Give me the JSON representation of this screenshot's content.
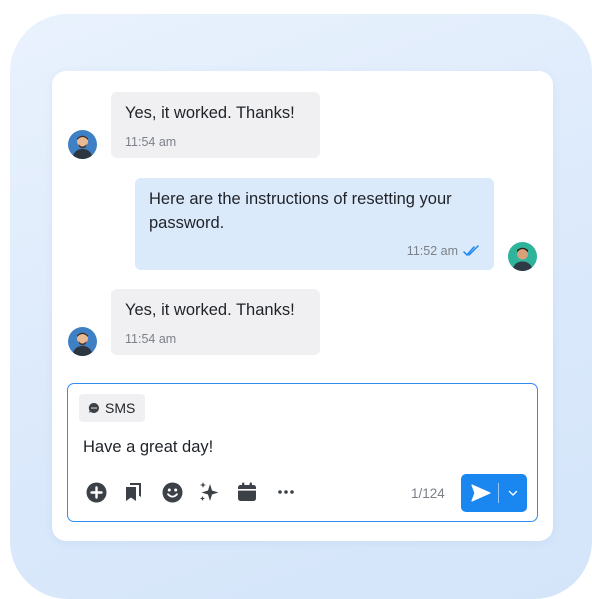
{
  "messages": [
    {
      "direction": "incoming",
      "text": "Yes, it worked. Thanks!",
      "time": "11:54 am"
    },
    {
      "direction": "outgoing",
      "text_line1": "Here are the instructions of resetting your",
      "text_line2": "password.",
      "time": "11:52 am",
      "status_icon": "double-check-icon"
    },
    {
      "direction": "incoming",
      "text": "Yes, it worked. Thanks!",
      "time": "11:54 am"
    }
  ],
  "composer": {
    "channel_label": "SMS",
    "channel_icon": "chat-bubble-icon",
    "message_text": "Have a great day!",
    "char_counter": "1/124",
    "tools": [
      "add-circle-icon",
      "bookmarks-icon",
      "emoji-icon",
      "sparkle-icon",
      "calendar-icon",
      "more-icon"
    ],
    "send_icon": "send-icon",
    "dropdown_icon": "chevron-down-icon"
  },
  "colors": {
    "accent": "#1a86f0",
    "incoming_bubble": "#f0f0f2",
    "outgoing_bubble": "#dbeafb",
    "read_check": "#1a86f0"
  }
}
